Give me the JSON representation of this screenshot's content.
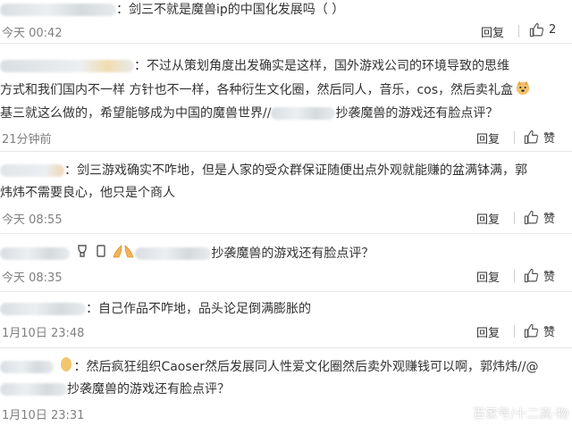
{
  "comments": [
    {
      "lines": [
        "：剑三不就是魔兽ip的中国化发展吗（ ）"
      ],
      "time": "今天 00:42",
      "reply": "回复",
      "like": "2"
    },
    {
      "lines": [
        "：不过从策划角度出发确实是这样，国外游戏公司的环境导致的思维",
        "方式和我们国内不一样 方针也不一样，各种衍生文化圈，然后同人，音乐，cos，然后卖礼盒",
        "基三就这么做的，希望能够成为中国的魔兽世界//",
        "抄袭魔兽的游戏还有脸点评？"
      ],
      "time": "21分钟前",
      "reply": "回复",
      "like": "赞"
    },
    {
      "lines": [
        "：剑三游戏确实不咋地，但是人家的受众群保证随便出点外观就能赚的盆满钵满，郭",
        "炜炜不需要良心，他只是个商人"
      ],
      "time": "今天 08:55",
      "reply": "回复",
      "like": "赞"
    },
    {
      "lines": [
        "抄袭魔兽的游戏还有脸点评？"
      ],
      "time": "今天 08:35",
      "reply": "回复",
      "like": "赞"
    },
    {
      "lines": [
        "：自己作品不咋地，品头论足倒满膨胀的"
      ],
      "time": "1月10日 23:48",
      "reply": "回复",
      "like": "赞"
    },
    {
      "lines": [
        "：然后疯狂组织Caoser然后发展同人性爱文化圈然后卖外观赚钱可以啊，郭炜炜//@",
        "抄袭魔兽的游戏还有脸点评？"
      ],
      "time": "1月10日 23:31",
      "reply": "回复",
      "like": "赞"
    }
  ],
  "watermark": "百家号/十二高·物",
  "colors": {
    "divider": "#e6e6e6",
    "time": "#808080",
    "text": "#333333"
  }
}
